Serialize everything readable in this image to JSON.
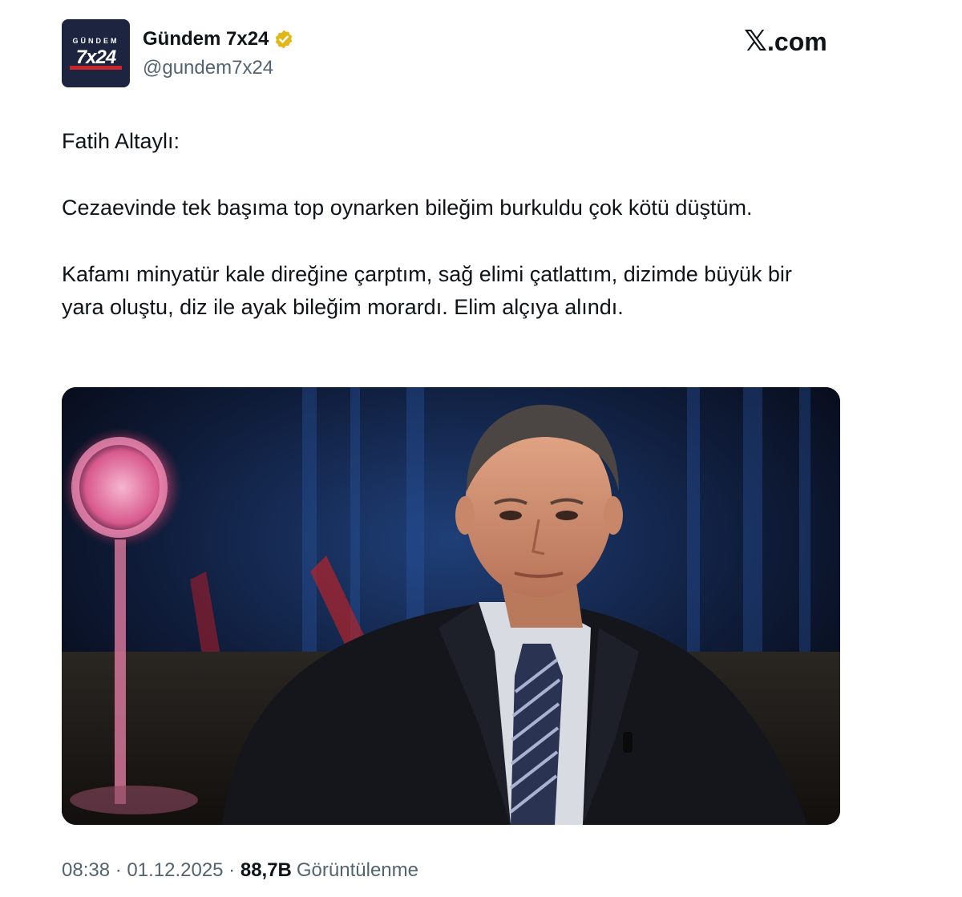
{
  "author": {
    "avatar_top_text": "GÜNDEM",
    "avatar_main_text": "7x24",
    "display_name": "Gündem 7x24",
    "handle": "@gundem7x24",
    "verified_icon": "verified-badge-gold"
  },
  "brand": {
    "logo_text": ".com",
    "logo_icon": "x-logo"
  },
  "post": {
    "lines": [
      "Fatih Altaylı:",
      "Cezaevinde tek başıma top oynarken bileğim burkuldu çok kötü düştüm.",
      "Kafamı minyatür kale direğine çarptım, sağ elimi çatlattım, dizimde büyük bir yara oluştu, diz ile ayak bileğim morardı. Elim alçıya alındı."
    ]
  },
  "media": {
    "subject": "photo of a man in a dark suit and striped tie in a TV studio"
  },
  "meta": {
    "time": "08:38",
    "sep1": " · ",
    "date": "01.12.2025",
    "sep2": " · ",
    "views_count": "88,7B",
    "views_label": "Görüntülenme"
  },
  "colors": {
    "text": "#0f1419",
    "secondary": "#536471",
    "verified": "#e2b719",
    "avatar_bg": "#1c2440"
  }
}
